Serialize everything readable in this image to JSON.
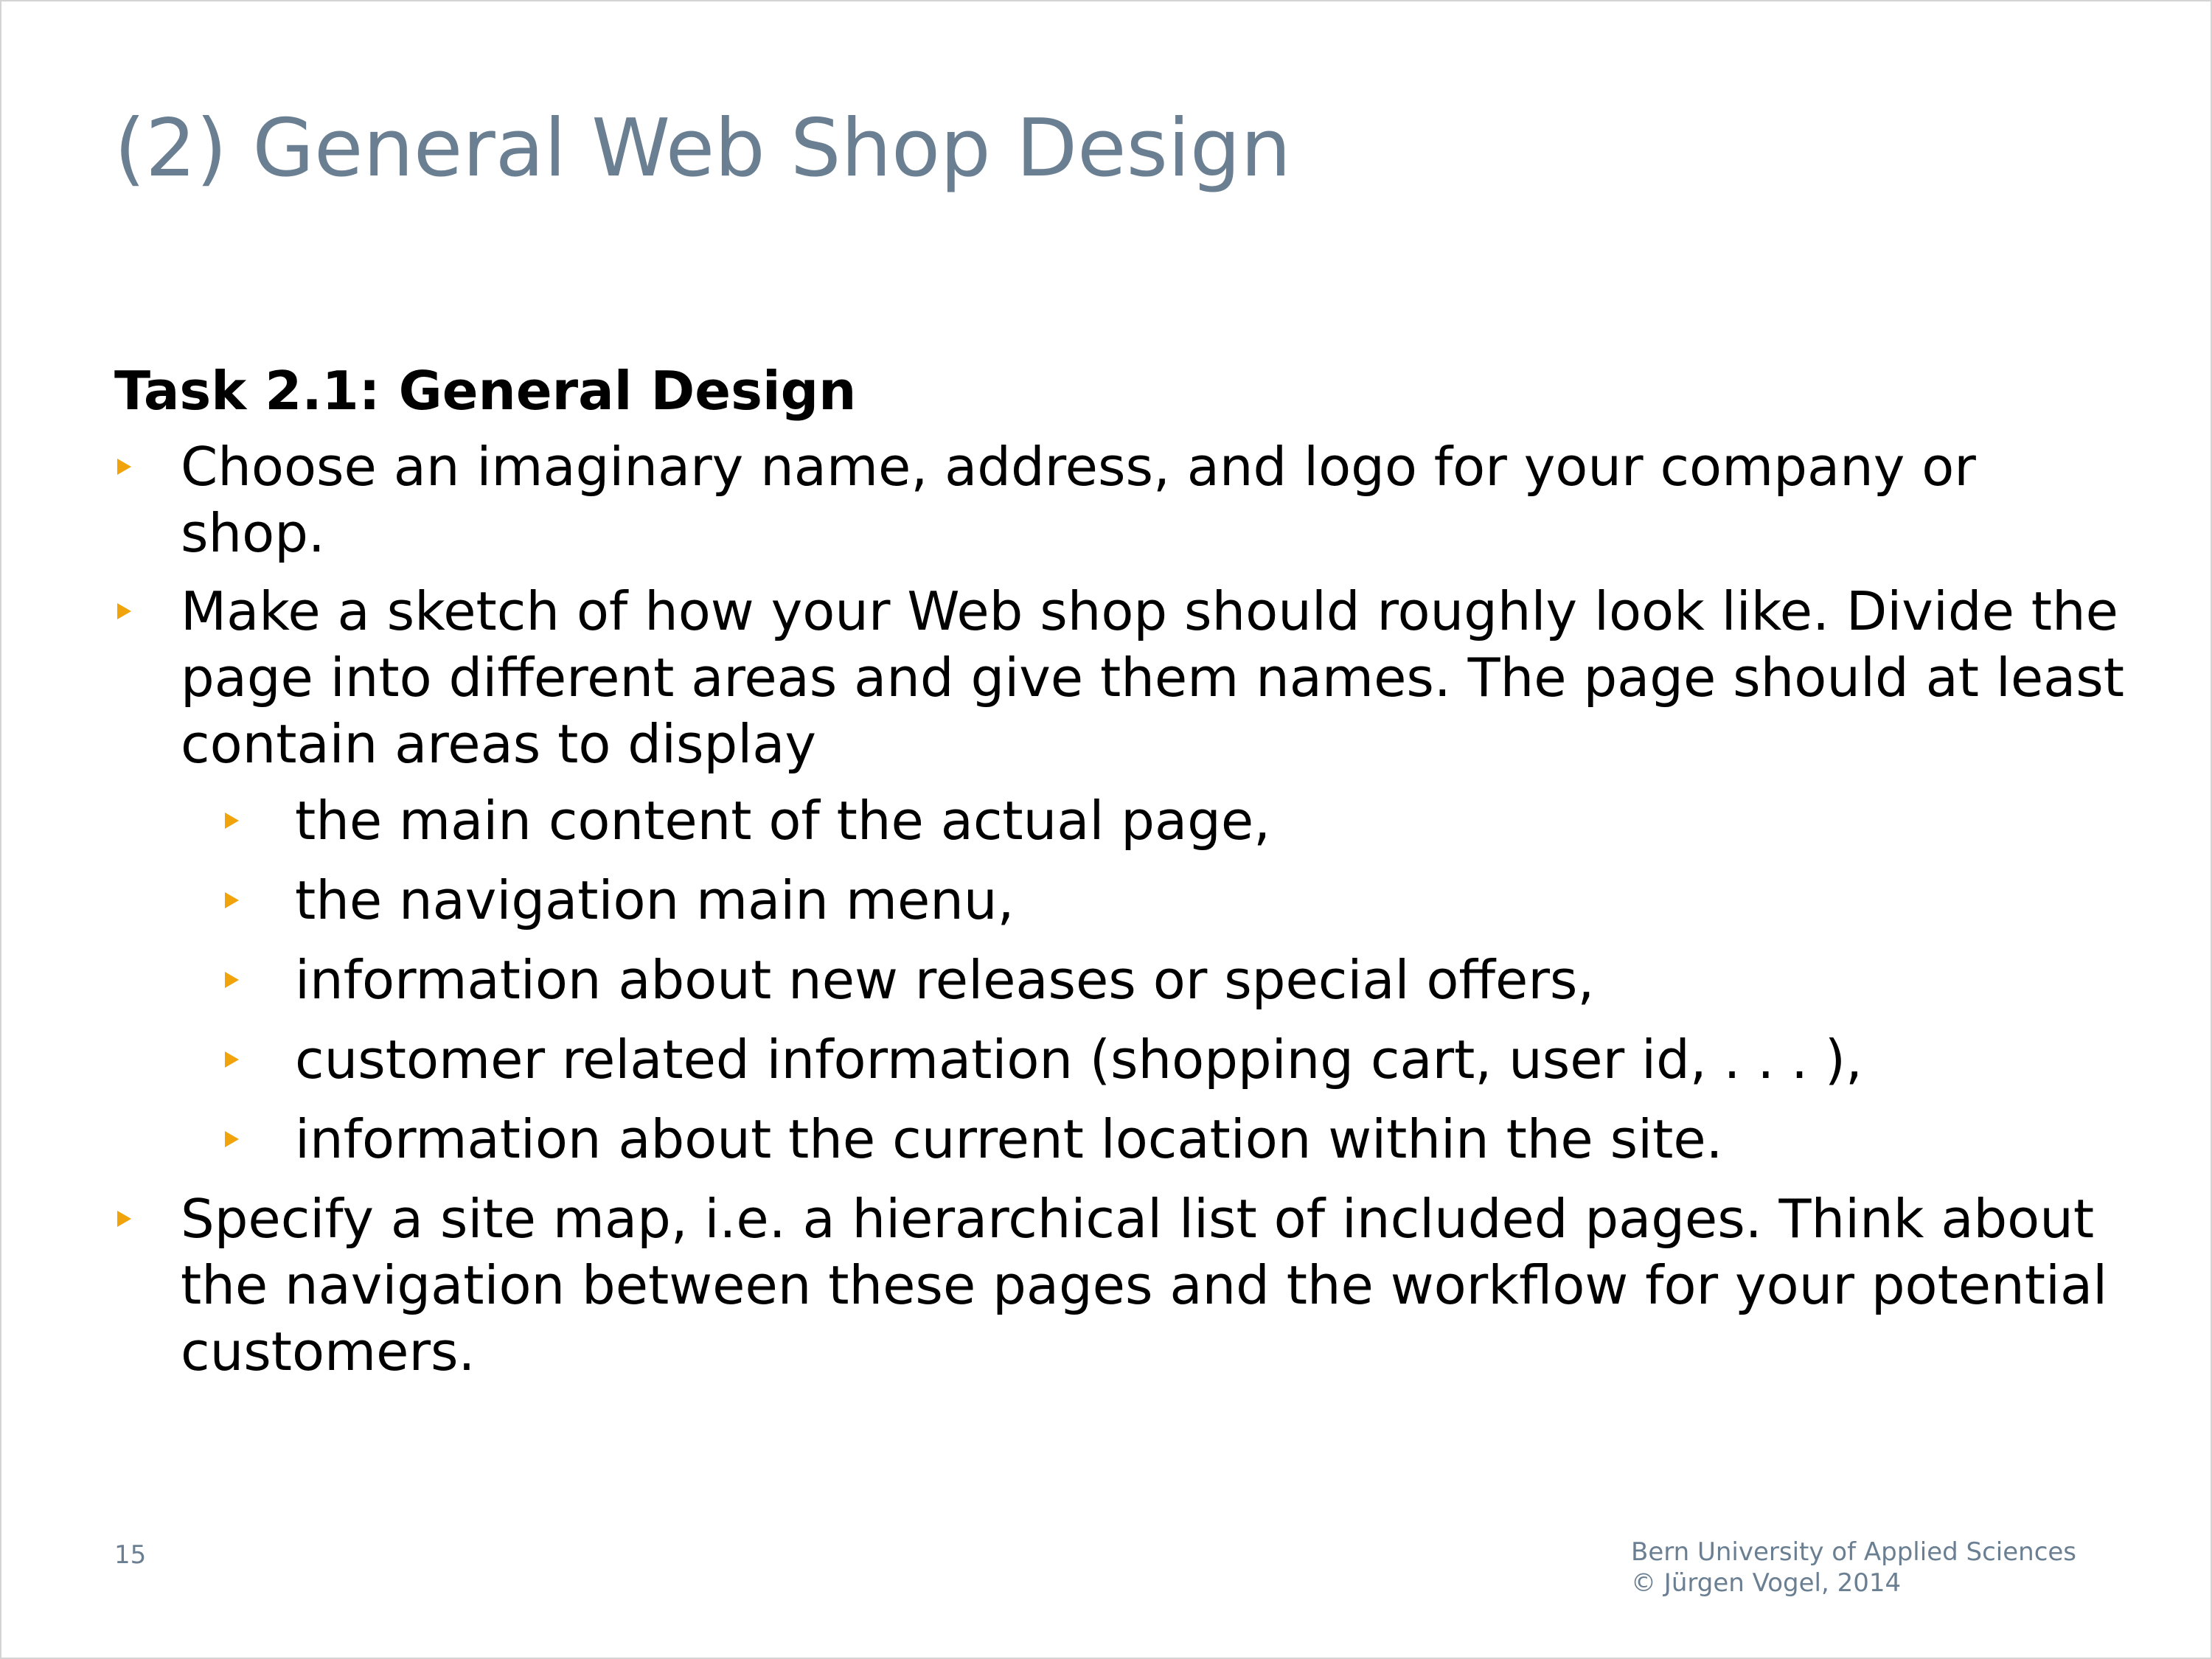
{
  "title": "(2) General Web Shop Design",
  "task_heading": "Task 2.1: General Design",
  "bullets": [
    {
      "text": "Choose an imaginary name, address, and logo for your company or shop."
    },
    {
      "text": "Make a sketch of how your Web shop should roughly look like. Divide the page into different areas and give them names. The page should at least contain areas to display",
      "subitems": [
        "the main content of the actual page,",
        "the navigation main menu,",
        "information about new releases or special offers,",
        "customer related information (shopping cart, user id, . . . ),",
        "information about the current location within the site."
      ]
    },
    {
      "text": "Specify a site map, i.e. a hierarchical list of included pages. Think about the navigation between these pages and the workflow for your potential customers."
    }
  ],
  "page_number": "15",
  "footer": {
    "line1": "Bern University of Applied Sciences",
    "line2": "© Jürgen Vogel, 2014"
  },
  "colors": {
    "title": "#6b7f92",
    "bullet": "#f0a30a",
    "text": "#000000"
  }
}
